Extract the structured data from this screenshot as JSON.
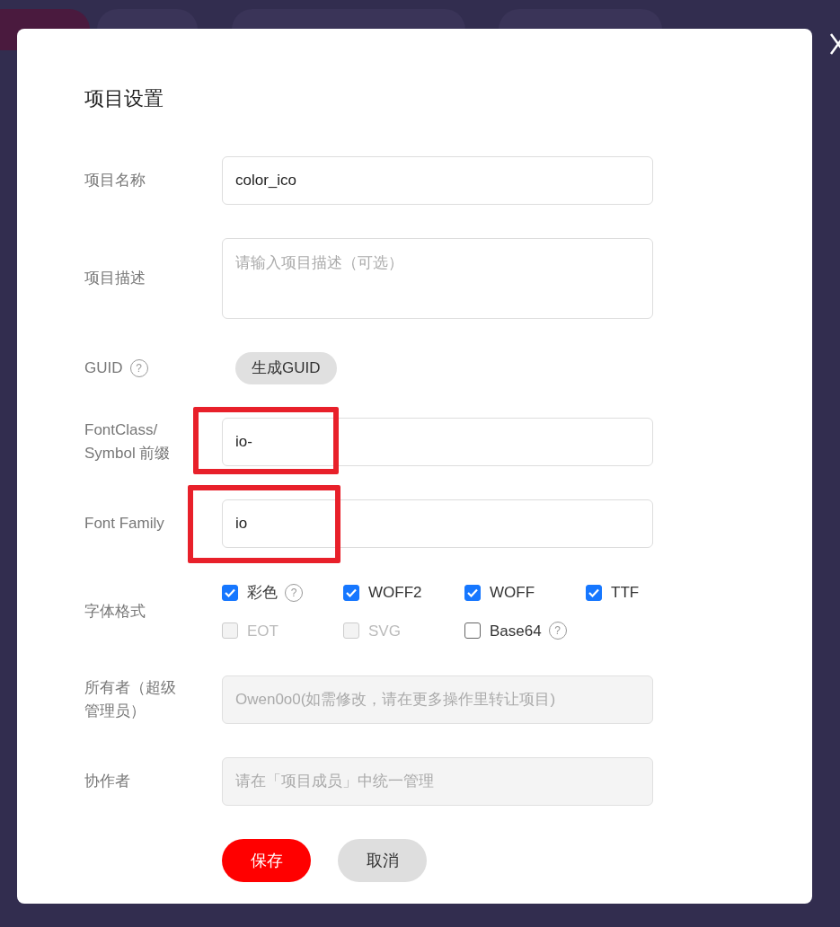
{
  "dialog": {
    "title": "项目设置",
    "fields": [
      {
        "kind": "input",
        "label": "项目名称",
        "value": "color_ico",
        "disabled": false,
        "highlighted": false
      },
      {
        "kind": "textarea",
        "label": "项目描述",
        "placeholder": "请输入项目描述（可选）",
        "highlighted": false
      },
      {
        "kind": "action",
        "label": "GUID",
        "help": "?",
        "button": "生成GUID",
        "highlighted": false
      },
      {
        "kind": "input",
        "label": "FontClass/ Symbol 前缀",
        "value": "io-",
        "disabled": false,
        "highlighted": true
      },
      {
        "kind": "input",
        "label": "Font Family",
        "value": "io",
        "disabled": false,
        "highlighted": true
      },
      {
        "kind": "checks",
        "label": "字体格式",
        "highlighted": false,
        "options": [
          {
            "label": "彩色",
            "checked": true,
            "disabled": false,
            "help": "?"
          },
          {
            "label": "WOFF2",
            "checked": true,
            "disabled": false
          },
          {
            "label": "WOFF",
            "checked": true,
            "disabled": false
          },
          {
            "label": "TTF",
            "checked": true,
            "disabled": false
          },
          {
            "label": "EOT",
            "checked": false,
            "disabled": true
          },
          {
            "label": "SVG",
            "checked": false,
            "disabled": true
          },
          {
            "label": "Base64",
            "checked": false,
            "disabled": false,
            "help": "?"
          }
        ]
      },
      {
        "kind": "input",
        "label": "所有者（超级管理员）",
        "placeholder": "Owen0o0(如需修改，请在更多操作里转让项目)",
        "disabled": true,
        "highlighted": false
      },
      {
        "kind": "input",
        "label": "协作者",
        "placeholder": "请在「项目成员」中统一管理",
        "disabled": true,
        "highlighted": false
      }
    ],
    "buttons": [
      {
        "label": "保存",
        "primary": true
      },
      {
        "label": "取消",
        "primary": false
      }
    ]
  }
}
